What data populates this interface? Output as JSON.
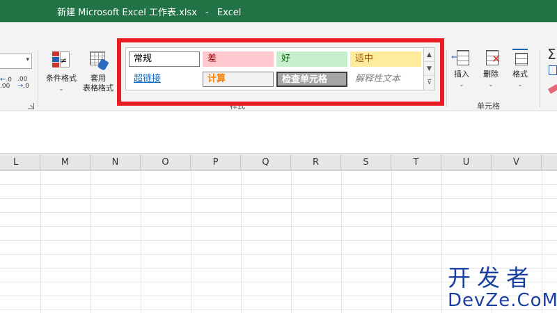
{
  "window": {
    "file_title": "新建 Microsoft Excel 工作表.xlsx",
    "separator": "-",
    "app_name": "Excel"
  },
  "ribbon": {
    "number_group": {
      "increase_decimal": "←.0 .00",
      "decrease_decimal": ".00 →.0"
    },
    "styles_group": {
      "label": "样式",
      "conditional_formatting": "条件格式",
      "format_as_table_line1": "套用",
      "format_as_table_line2": "表格格式",
      "gallery": [
        {
          "label": "常规",
          "bg": "#ffffff",
          "fg": "#000000",
          "border": "#7a7a7a"
        },
        {
          "label": "差",
          "bg": "#ffc7ce",
          "fg": "#9c0006",
          "border": "#ffc7ce"
        },
        {
          "label": "好",
          "bg": "#c6efce",
          "fg": "#006100",
          "border": "#c6efce"
        },
        {
          "label": "适中",
          "bg": "#ffeb9c",
          "fg": "#9c5700",
          "border": "#ffeb9c"
        },
        {
          "label": "超链接",
          "bg": "#ffffff",
          "fg": "#0563c1",
          "border": "#ffffff"
        },
        {
          "label": "计算",
          "bg": "#f2f2f2",
          "fg": "#fa7d00",
          "border": "#7f7f7f"
        },
        {
          "label": "检查单元格",
          "bg": "#a5a5a5",
          "fg": "#ffffff",
          "border": "#3f3f3f"
        },
        {
          "label": "解释性文本",
          "bg": "#ffffff",
          "fg": "#7f7f7f",
          "border": "#ffffff"
        }
      ],
      "scroll_up": "▲",
      "scroll_down": "▼",
      "more": "⊽"
    },
    "cells_group": {
      "label": "单元格",
      "insert": "插入",
      "delete": "删除",
      "format": "格式"
    },
    "dropdown_glyph": "⌄",
    "sigma": "Σ"
  },
  "columns": [
    "L",
    "M",
    "N",
    "O",
    "P",
    "Q",
    "R",
    "S",
    "T",
    "U",
    "V"
  ],
  "watermark": {
    "chinese": "开发者",
    "english": "DevZe.CoM"
  },
  "colors": {
    "titlebar": "#217346",
    "highlight": "#ea1c24"
  }
}
